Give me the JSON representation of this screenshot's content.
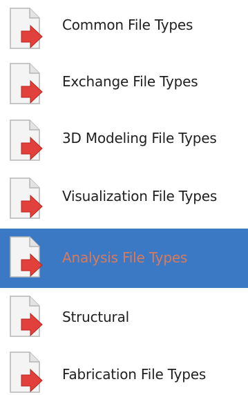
{
  "menu": {
    "items": [
      {
        "label": "Common File Types",
        "icon": "file-export-icon",
        "selected": false
      },
      {
        "label": "Exchange File Types",
        "icon": "file-export-icon",
        "selected": false
      },
      {
        "label": "3D Modeling File Types",
        "icon": "file-export-icon",
        "selected": false
      },
      {
        "label": "Visualization File Types",
        "icon": "file-export-icon",
        "selected": false
      },
      {
        "label": "Analysis File Types",
        "icon": "file-export-icon",
        "selected": true
      },
      {
        "label": "Structural",
        "icon": "file-export-icon",
        "selected": false
      },
      {
        "label": "Fabrication File Types",
        "icon": "file-export-icon",
        "selected": false
      }
    ]
  },
  "colors": {
    "selection_background": "#3b79c4",
    "selected_label": "#d97a5a",
    "label": "#1f1f1f",
    "arrow": "#e2403a"
  }
}
